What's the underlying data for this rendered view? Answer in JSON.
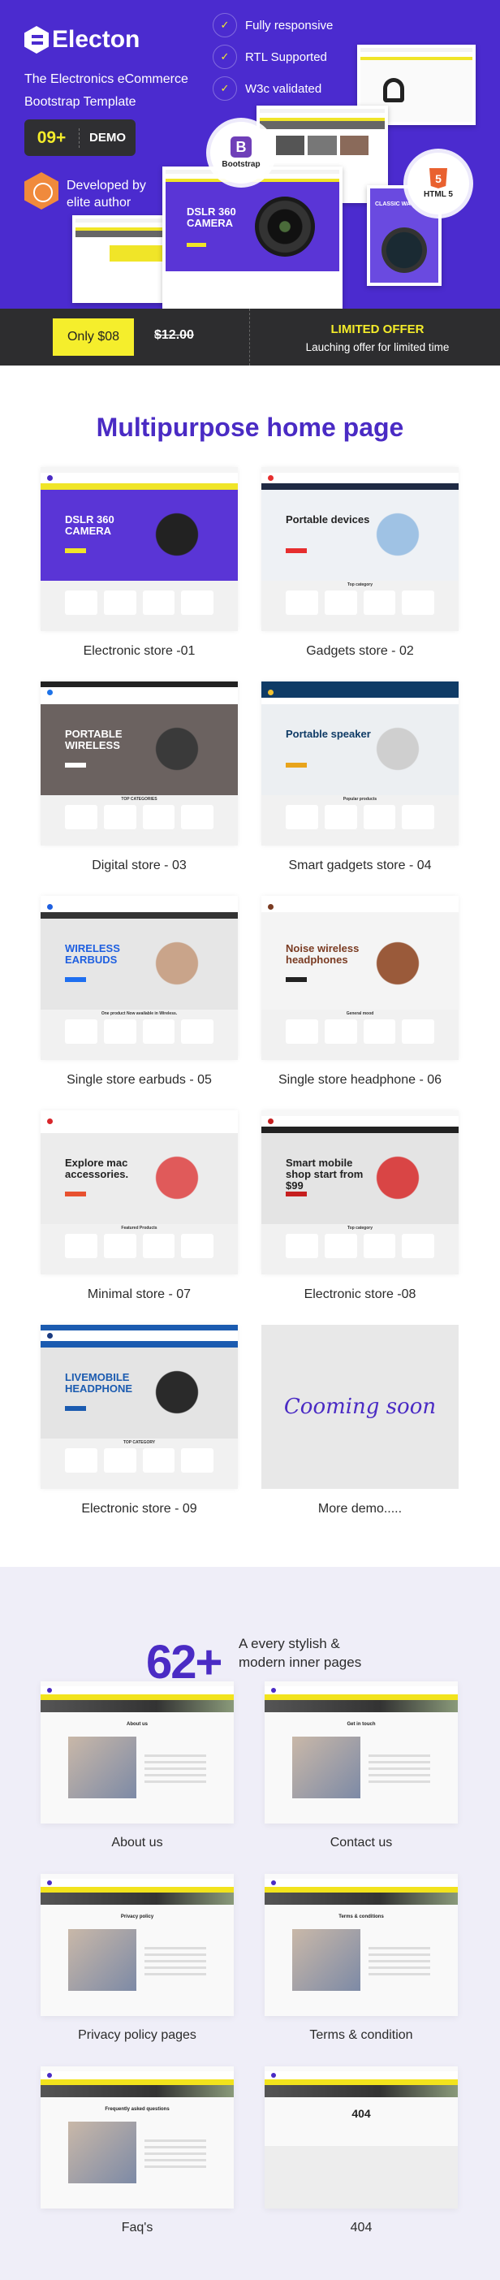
{
  "hero": {
    "brand": "Electon",
    "subtitle_line1": "The Electronics eCommerce",
    "subtitle_line2": "Bootstrap Template",
    "demo_count": "09+",
    "demo_label": "DEMO",
    "author_line1": "Developed by",
    "author_line2": "elite author",
    "features": [
      "Fully responsive",
      "RTL Supported",
      "W3c validated"
    ],
    "check_icon": "check-icon",
    "bootstrap_badge": "Bootstrap",
    "bootstrap_letter": "B",
    "html_badge": "HTML 5",
    "html_number": "5",
    "main_shot_title": "DSLR 360 CAMERA",
    "watch_shot_title": "CLASSIC WA",
    "colors": {
      "background": "#4b2bcf",
      "accent": "#f4ec2a"
    }
  },
  "offer": {
    "price": "Only $08",
    "old_price": "$12.00",
    "title": "LIMITED OFFER",
    "subtitle": "Lauching offer for limited time"
  },
  "home": {
    "title": "Multipurpose home page",
    "demos": [
      {
        "label": "Electronic store -01",
        "hero_title": "DSLR 360 CAMERA",
        "section": "",
        "colors": {
          "top": "#f5f5f5",
          "header": "#ffffff",
          "nav": "#f0e528",
          "hero": "#5a35d6",
          "hero_text": "#ffffff",
          "button": "#f0e528",
          "product": "#222222",
          "dot": "#4a2bc4"
        }
      },
      {
        "label": "Gadgets store - 02",
        "hero_title": "Portable devices",
        "section": "Top category",
        "colors": {
          "top": "#f5f5f5",
          "header": "#ffffff",
          "nav": "#1f2a44",
          "hero": "#eef1f5",
          "hero_text": "#222222",
          "button": "#e62e2e",
          "product": "#9fc2e4",
          "dot": "#e62e2e"
        }
      },
      {
        "label": "Digital store - 03",
        "hero_title": "PORTABLE WIRELESS",
        "section": "TOP CATEGORIES",
        "colors": {
          "top": "#222222",
          "header": "#ffffff",
          "nav": "#ffffff",
          "hero": "#6b6260",
          "hero_text": "#ffffff",
          "button": "#ffffff",
          "product": "#3a3a3a",
          "dot": "#1e73e8"
        }
      },
      {
        "label": "Smart gadgets store - 04",
        "hero_title": "Portable speaker",
        "section": "Popular products",
        "colors": {
          "top": "#0f3b66",
          "header": "#0f3b66",
          "nav": "#ffffff",
          "hero": "#eceff2",
          "hero_text": "#0f3b66",
          "button": "#e8a41c",
          "product": "#cfcfcf",
          "dot": "#f2c230"
        }
      },
      {
        "label": "Single store earbuds - 05",
        "hero_title": "WIRELESS EARBUDS",
        "section": "One product Now available in Wireless.",
        "colors": {
          "top": "#ffffff",
          "header": "#ffffff",
          "nav": "#333333",
          "hero": "#e6e6e6",
          "hero_text": "#1e5fe0",
          "button": "#1e6ff0",
          "product": "#c9a48a",
          "dot": "#1e5fe0"
        }
      },
      {
        "label": "Single store headphone - 06",
        "hero_title": "Noise wireless headphones",
        "section": "General mood",
        "colors": {
          "top": "#ffffff",
          "header": "#ffffff",
          "nav": "#f4f4f4",
          "hero": "#f4f4f4",
          "hero_text": "#7a3b22",
          "button": "#222222",
          "product": "#9a5a3a",
          "dot": "#7a3b22"
        }
      },
      {
        "label": "Minimal store - 07",
        "hero_title": "Explore mac accessories.",
        "section": "Featured Products",
        "colors": {
          "top": "#ffffff",
          "header": "#ffffff",
          "nav": "#ffffff",
          "hero": "#ececec",
          "hero_text": "#222222",
          "button": "#e8512f",
          "product": "#e05a5a",
          "dot": "#d8262b"
        }
      },
      {
        "label": "Electronic store -08",
        "hero_title": "Smart mobile shop start from $99",
        "section": "Top category",
        "colors": {
          "top": "#f7f7f7",
          "header": "#ffffff",
          "nav": "#222222",
          "hero": "#e4e4e4",
          "hero_text": "#222222",
          "button": "#c61f1f",
          "product": "#d94545",
          "dot": "#c61f1f"
        }
      },
      {
        "label": "Electronic store - 09",
        "hero_title": "LIVEMOBILE HEADPHONE",
        "section": "TOP CATEGORY",
        "colors": {
          "top": "#1b5bb0",
          "header": "#ffffff",
          "nav": "#1b5bb0",
          "hero": "#e4e4e4",
          "hero_text": "#1b5bb0",
          "button": "#1b5bb0",
          "product": "#2a2a2a",
          "dot": "#1b3b80"
        }
      }
    ],
    "more": {
      "label": "More demo.....",
      "placeholder": "Cooming soon"
    }
  },
  "inner": {
    "count": "62+",
    "tagline_line1": "A every stylish &",
    "tagline_line2": "modern inner pages",
    "pages": [
      {
        "label": "About us",
        "heading": "About us"
      },
      {
        "label": "Contact us",
        "heading": "Get in touch"
      },
      {
        "label": "Privacy policy pages",
        "heading": "Privacy policy"
      },
      {
        "label": "Terms & condition",
        "heading": "Terms & conditions"
      },
      {
        "label": "Faq's",
        "heading": "Frequently asked questions"
      },
      {
        "label": "404",
        "heading": "404"
      }
    ],
    "colors": {
      "background": "#efeef8",
      "accent": "#4a2bc4"
    }
  }
}
